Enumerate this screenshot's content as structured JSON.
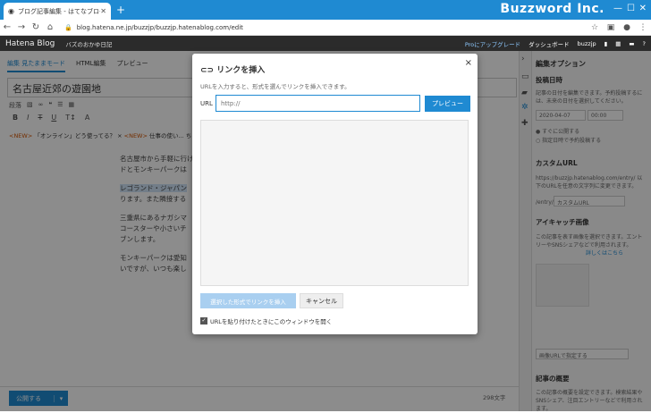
{
  "browser": {
    "tab_title": "ブログ記事編集 - はてなブログ",
    "url": "blog.hatena.ne.jp/buzzjp/buzzjp.hatenablog.com/edit",
    "brand": "Buzzword Inc."
  },
  "hatena": {
    "logo": "Hatena Blog",
    "blog_name": "バズのおかゆ日記",
    "pro_upgrade": "Proにアップグレード",
    "dashboard": "ダッシュボード",
    "user": "buzzjp"
  },
  "editor": {
    "modes": [
      "編集 見たままモード",
      "HTML編集",
      "プレビュー"
    ],
    "title": "名古屋近郊の遊園地",
    "format_label": "段落",
    "news": [
      {
        "tag": "<NEW>",
        "text": "「オンライン」どう使ってる？ ×"
      },
      {
        "tag": "<NEW>",
        "text": "仕事の使い..."
      },
      {
        "tag": "",
        "text": "ちっと見る"
      }
    ],
    "paragraphs": [
      "名古屋市から手軽に行け",
      "ドとモンキーパークは",
      "レゴランド・ジャパン",
      "ります。また隣接する",
      "三重県にあるナガシマ",
      "コースターや小さいチ",
      "ブンします。",
      "モンキーパークは愛知",
      "いですが、いつも楽し"
    ],
    "publish": "公開する",
    "word_count": "298文字"
  },
  "sidebar": {
    "title": "編集オプション",
    "post_date_heading": "投稿日時",
    "post_date_desc": "記事の日付を編集できます。予約投稿するには、未来の日付を選択してください。",
    "date_value": "2020-04-07",
    "time_value": "00:00",
    "radio_publish_now": "すぐに公開する",
    "radio_schedule": "指定日時で予約投稿する",
    "custom_url_heading": "カスタムURL",
    "custom_url_desc": "https://buzzjp.hatenablog.com/entry/ 以下のURLを任意の文字列に変更できます。",
    "custom_url_prefix": "/entry/",
    "custom_url_placeholder": "カスタムURL",
    "eyecatch_heading": "アイキャッチ画像",
    "eyecatch_desc": "この記事を表す画像を選択できます。エントリーやSNSシェアなどで利用されます。",
    "eyecatch_link": "詳しくはこちら",
    "image_url_placeholder": "画像URLで指定する",
    "summary_heading": "記事の概要",
    "summary_desc": "この記事の概要を設定できます。検索結果やSNSシェア、注目エントリーなどで利用されます。"
  },
  "modal": {
    "title": "リンクを挿入",
    "close": "×",
    "description": "URLを入力すると、形式を選んでリンクを挿入できます。",
    "url_label": "URL",
    "url_placeholder": "http://",
    "preview_button": "プレビュー",
    "insert_button": "選択した形式でリンクを挿入",
    "cancel_button": "キャンセル",
    "checkbox_label": "URLを貼り付けたときにこのウィンドウを開く",
    "checkbox_checked": true
  }
}
